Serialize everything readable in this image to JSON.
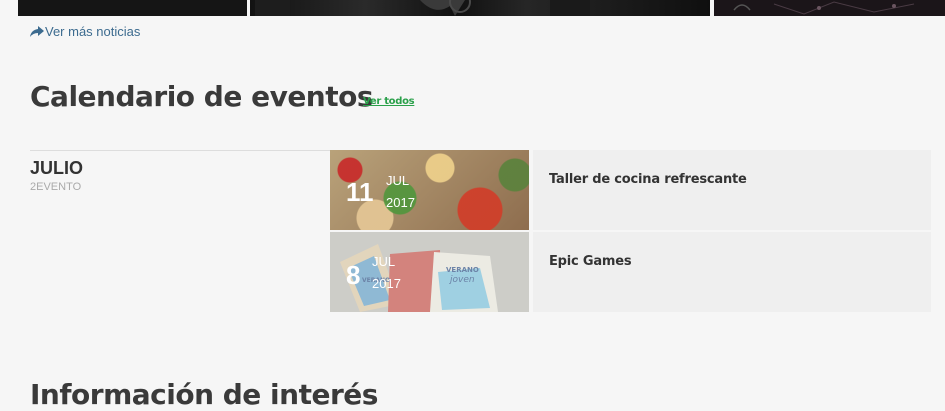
{
  "news": {
    "more_link": "Ver más noticias"
  },
  "events": {
    "title": "Calendario de eventos",
    "see_all": "Ver todos",
    "month": "JULIO",
    "count": "2EVENTO",
    "items": [
      {
        "day": "11",
        "month": "JUL",
        "year": "2017",
        "title": "Taller de cocina refrescante"
      },
      {
        "day": "8",
        "month": "JUL",
        "year": "2017",
        "title": "Epic Games"
      }
    ]
  },
  "info": {
    "title": "Información de interés"
  },
  "colors": {
    "link": "#3c6b8f",
    "accent": "#2aa04a",
    "heading": "#3a3a3a",
    "card_bg": "#efefef"
  },
  "icons": {
    "more_link": "share-arrow-icon"
  }
}
